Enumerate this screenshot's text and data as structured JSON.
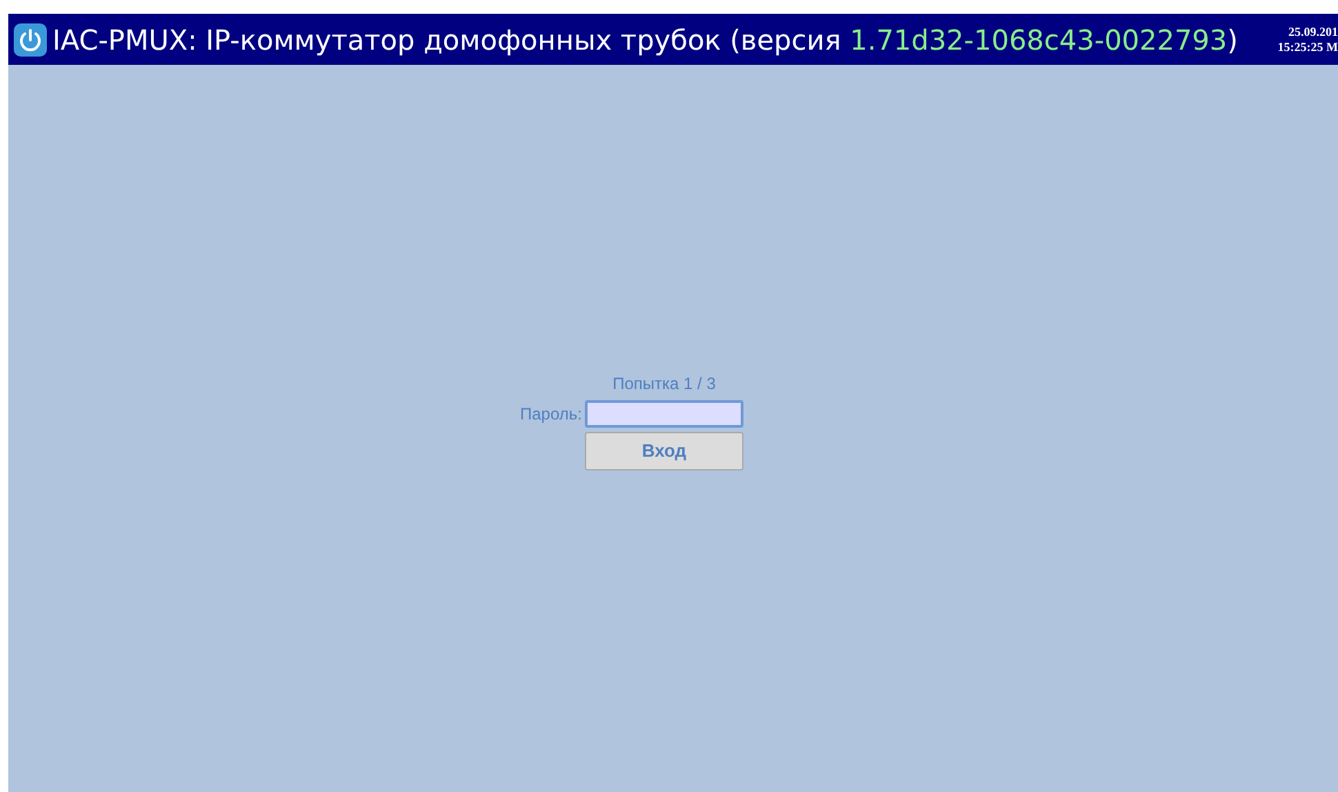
{
  "header": {
    "title": "IAC-PMUX: IP-коммутатор домофонных трубок (версия ",
    "version": "1.71d32-1068c43-0022793",
    "title_end": ")",
    "date": "25.09.201",
    "time": "15:25:25 M"
  },
  "login": {
    "attempt": "Попытка 1 / 3",
    "password_label": "Пароль:",
    "button": "Вход"
  }
}
